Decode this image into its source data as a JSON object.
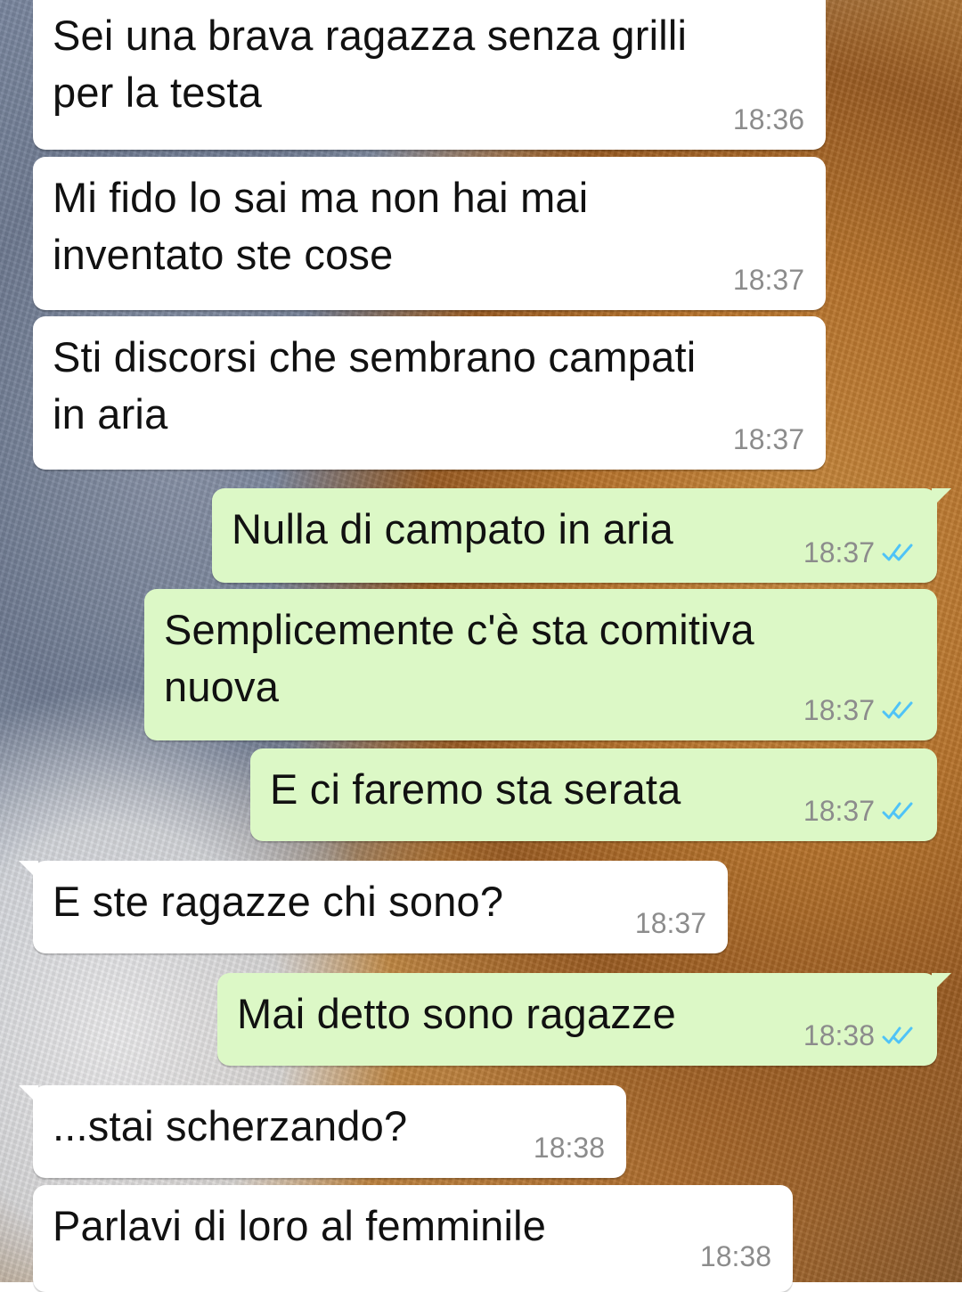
{
  "messages": [
    {
      "direction": "incoming",
      "text": "Sei una brava ragazza senza grilli\nper la testa",
      "time": "18:36"
    },
    {
      "direction": "incoming",
      "text": "Mi fido lo sai ma non hai mai\ninventato ste cose",
      "time": "18:37"
    },
    {
      "direction": "incoming",
      "text": "Sti discorsi che sembrano campati\nin aria",
      "time": "18:37"
    },
    {
      "direction": "outgoing",
      "text": "Nulla di campato in aria",
      "time": "18:37",
      "status": "read"
    },
    {
      "direction": "outgoing",
      "text": "Semplicemente c'è sta comitiva\nnuova",
      "time": "18:37",
      "status": "read"
    },
    {
      "direction": "outgoing",
      "text": "E ci faremo sta serata",
      "time": "18:37",
      "status": "read"
    },
    {
      "direction": "incoming",
      "text": "E ste ragazze chi sono?",
      "time": "18:37"
    },
    {
      "direction": "outgoing",
      "text": "Mai detto sono ragazze",
      "time": "18:38",
      "status": "read"
    },
    {
      "direction": "incoming",
      "text": "...stai scherzando?",
      "time": "18:38"
    },
    {
      "direction": "incoming",
      "text": "Parlavi di loro al femminile",
      "time": "18:38"
    }
  ],
  "colors": {
    "incoming_bubble": "#ffffff",
    "outgoing_bubble": "#dcf8c6",
    "read_ticks": "#4fc3f7",
    "timestamp": "#8c8c8c"
  },
  "icons": {
    "read_status": "double-check-icon"
  }
}
